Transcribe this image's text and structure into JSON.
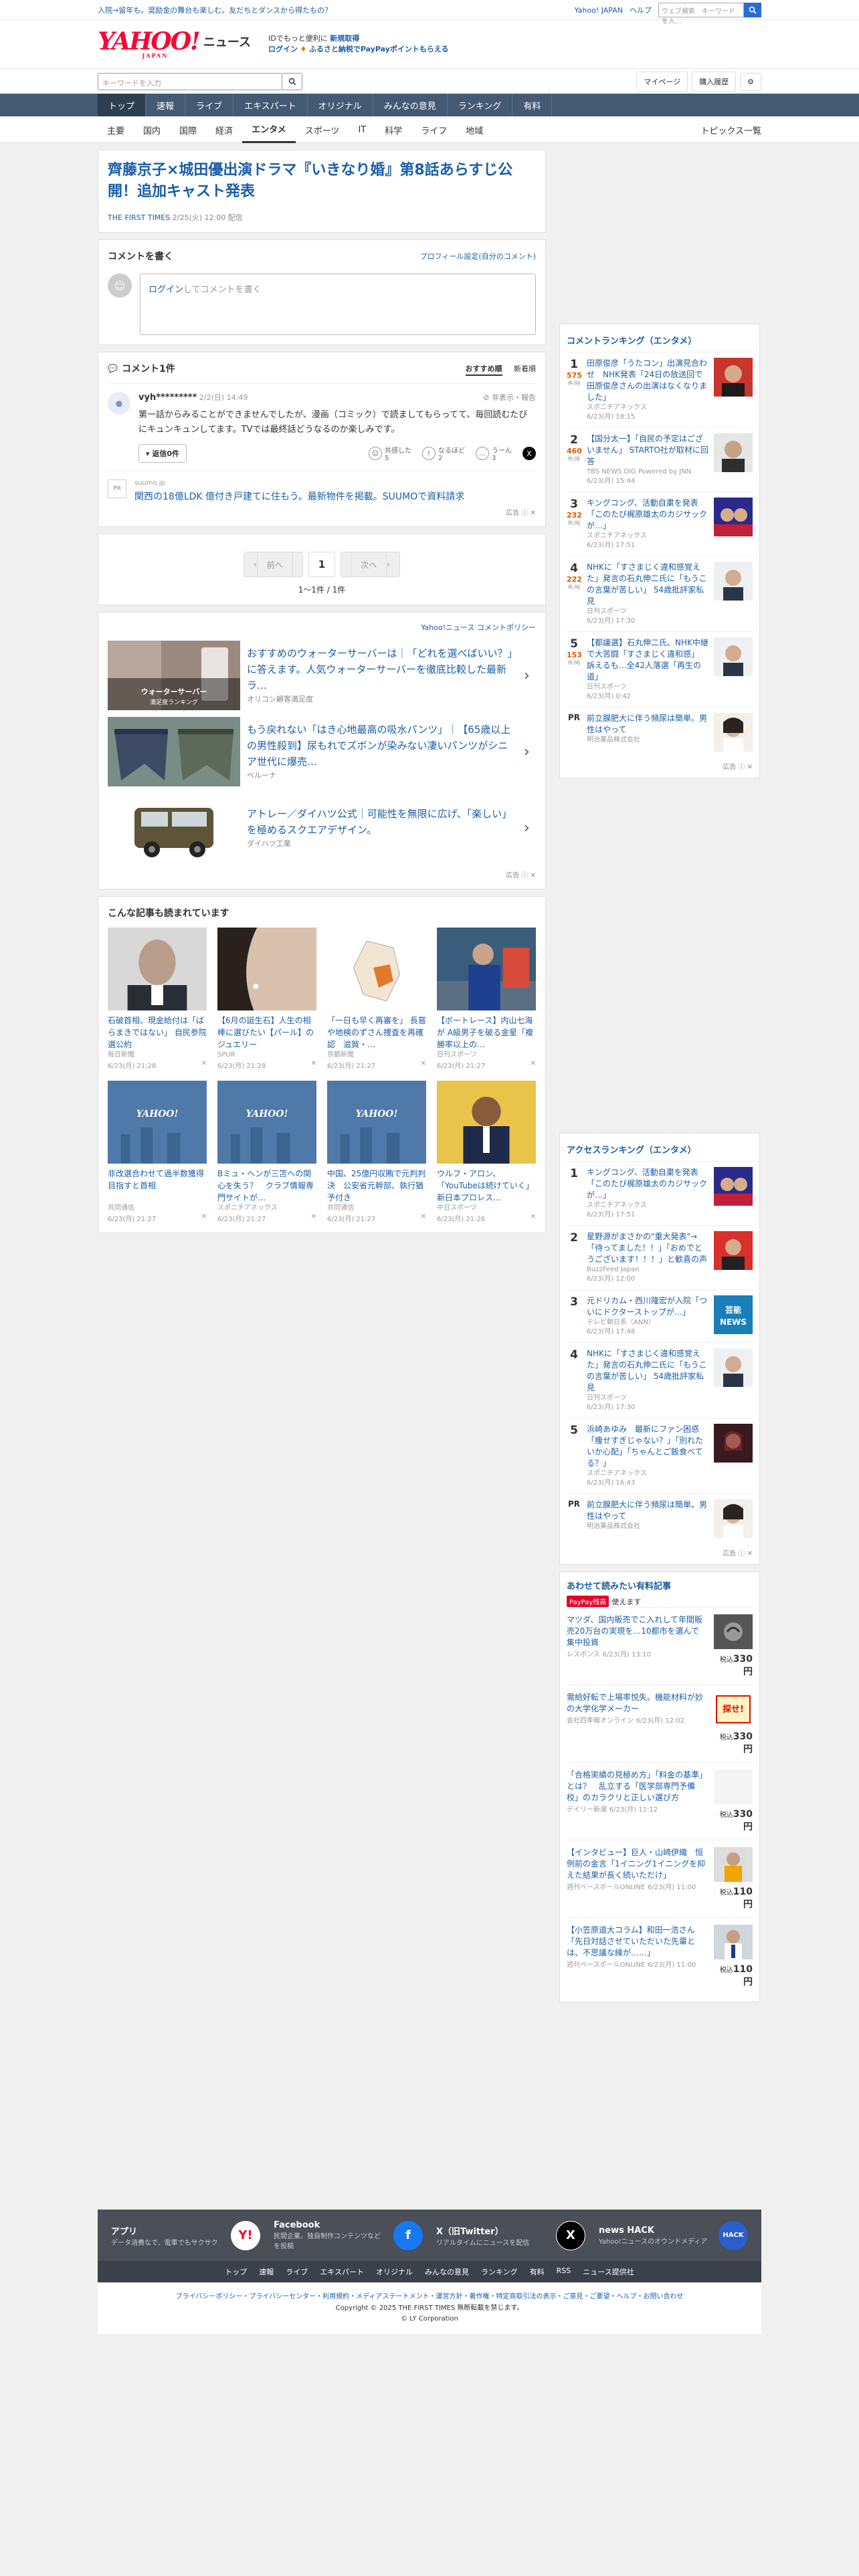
{
  "topbar": {
    "promo": "入院→留年も。奨励金の舞台も楽しむ。友だちとダンスから得たもの？",
    "links": [
      "Yahoo! JAPAN",
      "ヘルプ"
    ],
    "search_placeholder": "ウェブ検索",
    "search_hint": "　キーワードを入..."
  },
  "header": {
    "logo": "YAHOO!",
    "logo_sub": "JAPAN",
    "logo_news": "ニュース",
    "promo_line1": "IDでもっと便利に",
    "promo_link1": "新規取得",
    "promo_line2": "ログイン",
    "promo_line2b": "ふるさと納税でPayPayポイントもらえる"
  },
  "search": {
    "placeholder": "キーワードを入力",
    "mypage": "マイページ",
    "history": "購入履歴"
  },
  "gnav": [
    "トップ",
    "速報",
    "ライブ",
    "エキスパート",
    "オリジナル",
    "みんなの意見",
    "ランキング",
    "有料"
  ],
  "snav": [
    "主要",
    "国内",
    "国際",
    "経済",
    "エンタメ",
    "スポーツ",
    "IT",
    "科学",
    "ライフ",
    "地域"
  ],
  "snav_right": "トピックス一覧",
  "article": {
    "title": "齊藤京子×城田優出演ドラマ『いきなり婚』第8話あらすじ公開！追加キャスト発表",
    "source": "THE FIRST TIMES",
    "date": "2/25(火) 12:00 配信"
  },
  "comment_write": {
    "heading": "コメントを書く",
    "profile_link": "プロフィール設定(自分のコメント)",
    "login": "ログイン",
    "placeholder": "してコメントを書く"
  },
  "comments": {
    "heading": "コメント1件",
    "sort_recommended": "おすすめ順",
    "sort_new": "新着順",
    "items": [
      {
        "user": "vyh*********",
        "time": "2/2(日) 14:49",
        "report": "非表示・報告",
        "text": "第一話からみることができませんでしたが、漫画（コミック）で読ましてもらってて、毎回読むたびにキュンキュンしてます。TVでは最終話どうなるのか楽しみです。",
        "reply": "返信0件",
        "reacts": [
          {
            "label": "共感した",
            "count": "5"
          },
          {
            "label": "なるほど",
            "count": "2"
          },
          {
            "label": "うーん",
            "count": "3"
          }
        ]
      }
    ]
  },
  "ad_comment": {
    "source": "suumo.jp",
    "logo": "PR",
    "title": "関西の18億LDK 億付き戸建てに住もう。最新物件を掲載。SUUMOで資料請求",
    "tag": "広告"
  },
  "pager": {
    "prev": "前へ",
    "current": "1",
    "next": "次へ",
    "count": "1〜1件 / 1件"
  },
  "policy": "Yahoo!ニュース コメントポリシー",
  "ads": [
    {
      "title": "おすすめのウォーターサーバーは｜「どれを選べばいい？」に答えます。人気ウォーターサーバーを徹底比較した最新ラ…",
      "source": "オリコン顧客満足度",
      "img_text": "ウォーターサーバー\n満足度ランキング"
    },
    {
      "title": "もう戻れない「はき心地最高の吸水パンツ」｜【65歳以上の男性殺到】尿もれでズボンが染みない凄いパンツがシニア世代に爆売…",
      "source": "ベルーナ",
      "img_text": ""
    },
    {
      "title": "アトレー／ダイハツ公式｜可能性を無限に広げ、「楽しい」を極めるスクエアデザイン。",
      "source": "ダイハツ工業",
      "img_text": ""
    }
  ],
  "ads_tag": "広告",
  "related": {
    "heading": "こんな記事も読まれています",
    "items": [
      {
        "title": "石破首相、現金給付は「ばらまきではない」 自民参院選公約",
        "source": "毎日新聞",
        "time": "6/23(月) 21:28"
      },
      {
        "title": "【6月の誕生石】人生の相棒に選びたい【パール】のジュエリー",
        "source": "SPUR",
        "time": "6/23(月) 21:28"
      },
      {
        "title": "「一日も早く再審を」 長嘗や地検のずさん捜査を再確認　滋賀・…",
        "source": "京都新聞",
        "time": "6/23(月) 21:27"
      },
      {
        "title": "【ボートレース】内山七海が A級男子を破る金星「複勝率以上の…",
        "source": "日刊スポーツ",
        "time": "6/23(月) 21:27"
      },
      {
        "title": "非改選合わせて過半数獲得目指すと首相",
        "source": "共同通信",
        "time": "6/23(月) 21:27"
      },
      {
        "title": "Bミュ・ヘンが三笘への関心を失う？　クラブ情報専門サイトが…",
        "source": "スポニチアネックス",
        "time": "6/23(月) 21:27"
      },
      {
        "title": "中国、25億円収賄で元判判決　公安省元幹部、執行猶予付き",
        "source": "共同通信",
        "time": "6/23(月) 21:27"
      },
      {
        "title": "ウルフ・アロン、「YouTubeは続けていく」 新日本プロレス…",
        "source": "中日スポーツ",
        "time": "6/23(月) 21:26"
      }
    ]
  },
  "ranking_comment": {
    "heading": "コメントランキング（エンタメ）",
    "unit": "件/時",
    "items": [
      {
        "rank": "1",
        "count": "575",
        "title": "田原俊彦「うたコン」出演見合わせ　NHK発表「24日の放送回で田原俊彦さんの出演はなくなりました」",
        "source": "スポニチアネックス",
        "time": "6/23(月) 18:15"
      },
      {
        "rank": "2",
        "count": "460",
        "title": "【国分太一】「自民の予定はございません」 STARTO社が取材に回答",
        "source": "TBS NEWS DIG Powered by JNN",
        "time": "6/23(月) 15:44"
      },
      {
        "rank": "3",
        "count": "232",
        "title": "キングコング、活動自粛を発表「このたび梶原雄太のカジサックが…」",
        "source": "スポニチアネックス",
        "time": "6/23(月) 17:51"
      },
      {
        "rank": "4",
        "count": "222",
        "title": "NHKに「すさまじく違和感覚えた」発言の石丸伸二氏に「もうこの言葉が苦しい」 54歳批評家私見",
        "source": "日刊スポーツ",
        "time": "6/23(月) 17:30"
      },
      {
        "rank": "5",
        "count": "153",
        "title": "【都議選】石丸伸二氏、NHK中継で大苦闘「すさまじく違和感」 訴えるも…全42人落選「再生の道」",
        "source": "日刊スポーツ",
        "time": "6/23(月) 0:42"
      }
    ],
    "pr": {
      "label": "PR",
      "title": "前立腺肥大に伴う頻尿は簡単。男性はやって",
      "source": "明治薬品株式会社"
    },
    "ad_tag": "広告"
  },
  "ranking_access": {
    "heading": "アクセスランキング（エンタメ）",
    "items": [
      {
        "rank": "1",
        "title": "キングコング、活動自粛を発表「このたび梶原雄太のカジサックが…」",
        "source": "スポニチアネックス",
        "time": "6/23(月) 17:51"
      },
      {
        "rank": "2",
        "title": "星野源がまさかの\"重大発表\"→「待ってました！！」「おめでとうございます！！！」と歓喜の声",
        "source": "BuzzFeed Japan",
        "time": "6/23(月) 12:00"
      },
      {
        "rank": "3",
        "title": "元ドリカム・西川隆宏が入院「ついにドクターストップが…」",
        "source": "テレビ朝日系（ANN）",
        "time": "6/23(月) 17:48"
      },
      {
        "rank": "4",
        "title": "NHKに「すさまじく違和感覚えた」発言の石丸伸二氏に「もうこの言葉が苦しい」 54歳批評家私見",
        "source": "日刊スポーツ",
        "time": "6/23(月) 17:30"
      },
      {
        "rank": "5",
        "title": "浜崎あゆみ　最新にファン困惑「痩せすぎじゃない？」「別れたいか心配」「ちゃんとご飯食べてる？」",
        "source": "スポニチアネックス",
        "time": "6/23(月) 16:43"
      }
    ],
    "pr": {
      "label": "PR",
      "title": "前立腺肥大に伴う頻尿は簡単。男性はやって",
      "source": "明治薬品株式会社"
    },
    "ad_tag": "広告"
  },
  "paid": {
    "heading": "あわせて読みたい有料記事",
    "badge": "PayPay残高",
    "badge_text": "使えます",
    "price_label": "税込",
    "items": [
      {
        "title": "マツダ、国内販売でこ入れして年間販売20万台の実現を…10都市を選んで集中投資",
        "source": "レスポンス",
        "time": "6/23(月) 13:10",
        "price": "330円"
      },
      {
        "title": "需給好転で上場率悦失。機能材料が妙の大学化学メーカー",
        "source": "会社四季報オンライン",
        "time": "6/23(月) 12:02",
        "price": "330円"
      },
      {
        "title": "「合格実績の見極め方」「料金の基準」とは？　乱立する「医学部専門予備校」のカラクリと正しい選び方",
        "source": "デイリー新潮",
        "time": "6/23(月) 11:12",
        "price": "330円"
      },
      {
        "title": "【インタビュー】巨人・山崎伊織　恒例前の金言「1イニング1イニングを抑えた結果が長く続いただけ」",
        "source": "週刊ベースボールONLINE",
        "time": "6/23(月) 11:00",
        "price": "110円"
      },
      {
        "title": "【小笠原道大コラム】和田一浩さん「先日対話させていただいた先輩とは、不思議な縁が……」",
        "source": "週刊ベースボールONLINE",
        "time": "6/23(月) 11:00",
        "price": "110円"
      }
    ]
  },
  "footer": {
    "apps": [
      {
        "name": "アプリ",
        "desc": "データ消費なで、電車でもサクサク",
        "icon": "Y!"
      },
      {
        "name": "Facebook",
        "desc": "民間企業。独自制作コンテンツなどを投稿",
        "icon": "f"
      },
      {
        "name": "X（旧Twitter）",
        "desc": "リアルタイムにニュースを配信",
        "icon": "X"
      },
      {
        "name": "news HACK",
        "desc": "Yahoo!ニュースのオウンドメディア",
        "icon": "HACK"
      }
    ],
    "nav": [
      "トップ",
      "速報",
      "ライブ",
      "エキスパート",
      "オリジナル",
      "みんなの意見",
      "ランキング",
      "有料",
      "RSS",
      "ニュース提供社"
    ],
    "links": "プライバシーポリシー・プライバシーセンター・利用規約・メディアステートメント・運営方針・著作権・特定商取引法の表示・ご意見・ご要望・ヘルプ・お問い合わせ",
    "copyright": "Copyright © 2025 THE FIRST TIMES 無断転載を禁じます。",
    "company": "© LY Corporation"
  }
}
